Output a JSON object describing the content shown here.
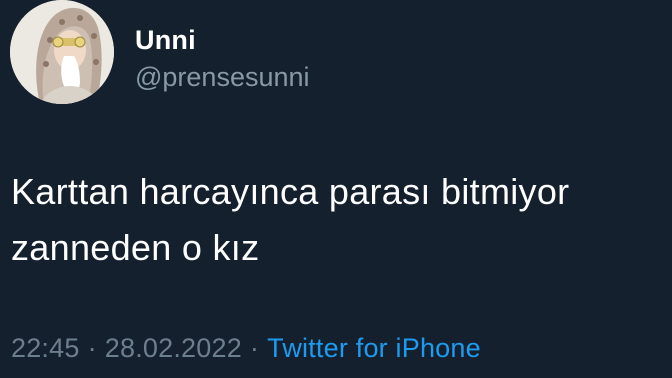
{
  "user": {
    "display_name": "Unni",
    "handle": "@prensesunni"
  },
  "tweet": {
    "text_line_1": "Karttan harcayınca parası bitmiyor",
    "text_line_2": "zanneden o kız",
    "time": "22:45",
    "separator": "·",
    "date": "28.02.2022",
    "source": "Twitter for iPhone"
  },
  "colors": {
    "background": "#14202e",
    "primary_text": "#ffffff",
    "secondary_text": "#8899a6",
    "link": "#1d9bf0"
  }
}
